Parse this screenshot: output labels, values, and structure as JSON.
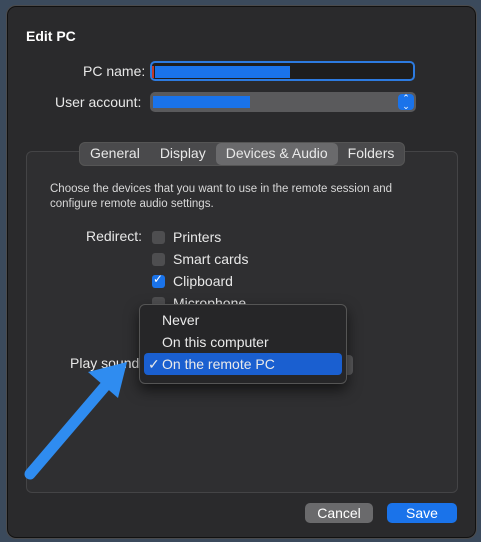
{
  "dialog": {
    "title": "Edit PC"
  },
  "form": {
    "pc_name_label": "PC name:",
    "user_account_label": "User account:"
  },
  "tabs": [
    {
      "label": "General"
    },
    {
      "label": "Display"
    },
    {
      "label": "Devices & Audio"
    },
    {
      "label": "Folders"
    }
  ],
  "devices": {
    "description": "Choose the devices that you want to use in the remote session and configure remote audio settings.",
    "redirect_label": "Redirect:",
    "options": [
      {
        "label": "Printers",
        "checked": false
      },
      {
        "label": "Smart cards",
        "checked": false
      },
      {
        "label": "Clipboard",
        "checked": true
      },
      {
        "label": "Microphone",
        "checked": false
      }
    ],
    "play_sound_label": "Play sound:",
    "play_sound_options": [
      {
        "label": "Never"
      },
      {
        "label": "On this computer"
      },
      {
        "label": "On the remote PC",
        "selected": true
      }
    ],
    "selected_mark": "✓"
  },
  "buttons": {
    "cancel": "Cancel",
    "save": "Save"
  },
  "colors": {
    "accent": "#1a73ea",
    "annotation_arrow": "#2f8cf0"
  }
}
